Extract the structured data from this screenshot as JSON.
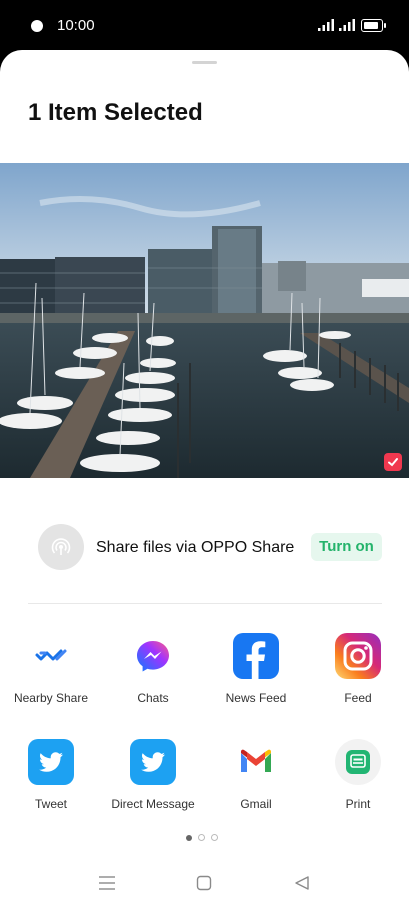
{
  "status_bar": {
    "time": "10:00"
  },
  "sheet": {
    "title": "1 Item Selected"
  },
  "oppo_share": {
    "label": "Share files via OPPO Share",
    "button": "Turn on"
  },
  "apps": [
    {
      "label": "Nearby Share",
      "icon": "nearby-share-icon"
    },
    {
      "label": "Chats",
      "icon": "messenger-icon"
    },
    {
      "label": "News Feed",
      "icon": "facebook-icon"
    },
    {
      "label": "Feed",
      "icon": "instagram-icon"
    },
    {
      "label": "Tweet",
      "icon": "twitter-icon"
    },
    {
      "label": "Direct Message",
      "icon": "twitter-icon"
    },
    {
      "label": "Gmail",
      "icon": "gmail-icon"
    },
    {
      "label": "Print",
      "icon": "print-icon"
    }
  ],
  "pagination": {
    "pages": 3,
    "current": 1
  },
  "colors": {
    "accent_green": "#24b36b",
    "check_red": "#f0384f",
    "twitter_blue": "#1da1f2",
    "facebook_blue": "#1877f2"
  }
}
